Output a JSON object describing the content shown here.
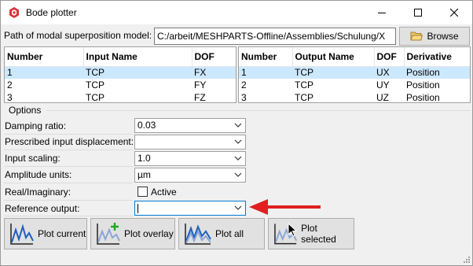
{
  "window": {
    "title": "Bode plotter"
  },
  "path": {
    "label": "Path of modal superposition model:",
    "value": "C:/arbeit/MESHPARTS-Offline/Assemblies/Schulung/X",
    "browse_label": "Browse"
  },
  "input_table": {
    "columns": [
      "Number",
      "Input Name",
      "DOF"
    ],
    "rows": [
      [
        "1",
        "TCP",
        "FX"
      ],
      [
        "2",
        "TCP",
        "FY"
      ],
      [
        "3",
        "TCP",
        "FZ"
      ]
    ],
    "selected_row": 1
  },
  "output_table": {
    "columns": [
      "Number",
      "Output Name",
      "DOF",
      "Derivative"
    ],
    "rows": [
      [
        "1",
        "TCP",
        "UX",
        "Position"
      ],
      [
        "2",
        "TCP",
        "UY",
        "Position"
      ],
      [
        "3",
        "TCP",
        "UZ",
        "Position"
      ]
    ],
    "selected_row": 1
  },
  "options": {
    "group_label": "Options",
    "damping_ratio": {
      "label": "Damping ratio:",
      "value": "0.03"
    },
    "prescribed_input": {
      "label": "Prescribed input displacement:",
      "value": ""
    },
    "input_scaling": {
      "label": "Input scaling:",
      "value": "1.0"
    },
    "amplitude_units": {
      "label": "Amplitude units:",
      "value": "µm"
    },
    "real_imaginary": {
      "label": "Real/Imaginary:",
      "checkbox_label": "Active",
      "checked": false
    },
    "reference_output": {
      "label": "Reference output:",
      "value": ""
    }
  },
  "buttons": {
    "plot_current": "Plot current",
    "plot_overlay": "Plot overlay",
    "plot_all": "Plot all",
    "plot_selected": "Plot selected"
  },
  "icons": {
    "app": "app-logo-icon",
    "browse": "folder-icon",
    "plot": "plot-curve-icon",
    "annotation": "red-arrow-icon"
  },
  "colors": {
    "selection": "#cce8ff",
    "annotation_arrow": "#e02020",
    "plot_icon_blue": "#1f5fbf",
    "overlay_plus_green": "#22aa22"
  }
}
